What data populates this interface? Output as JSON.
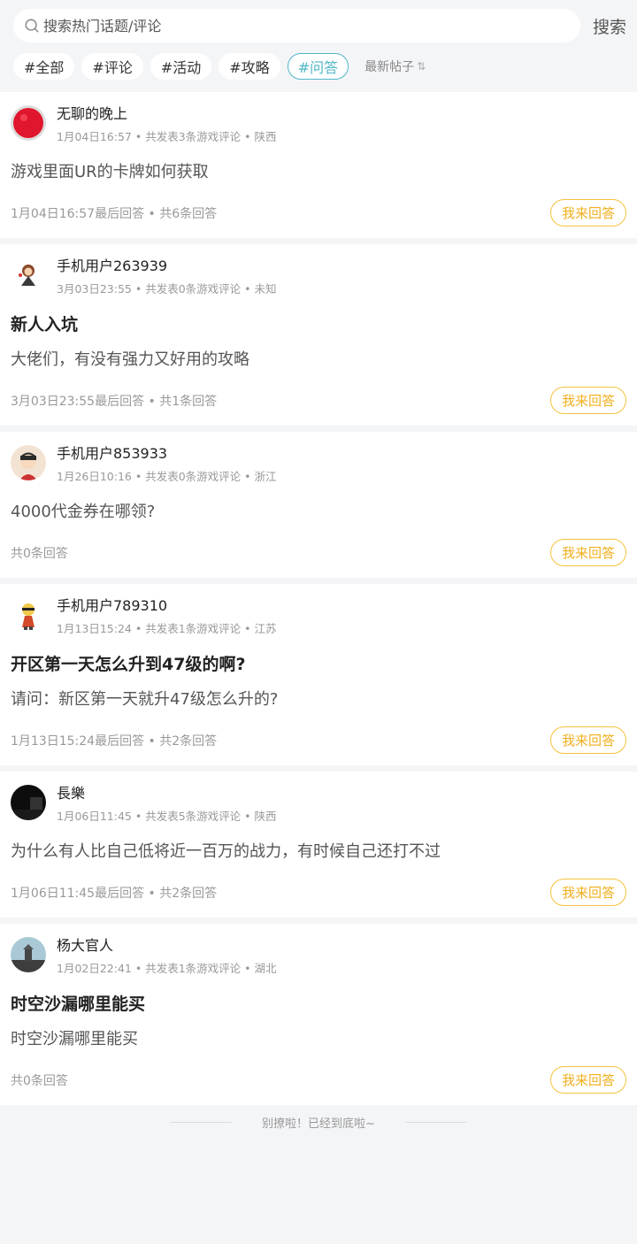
{
  "search": {
    "placeholder": "搜索热门话题/评论",
    "button": "搜索"
  },
  "tags": [
    {
      "label": "#全部",
      "active": false
    },
    {
      "label": "#评论",
      "active": false
    },
    {
      "label": "#活动",
      "active": false
    },
    {
      "label": "#攻略",
      "active": false
    },
    {
      "label": "#问答",
      "active": true
    }
  ],
  "sort": {
    "label": "最新帖子",
    "icon": "sort-arrows-icon"
  },
  "posts": [
    {
      "username": "无聊的晚上",
      "meta": "1月04日16:57 • 共发表3条游戏评论 • 陕西",
      "title": "",
      "body": "游戏里面UR的卡牌如何获取",
      "footer": "1月04日16:57最后回答 • 共6条回答",
      "button": "我来回答"
    },
    {
      "username": "手机用户263939",
      "meta": "3月03日23:55 • 共发表0条游戏评论 • 未知",
      "title": "新人入坑",
      "body": "大佬们，有没有强力又好用的攻略",
      "footer": "3月03日23:55最后回答 • 共1条回答",
      "button": "我来回答"
    },
    {
      "username": "手机用户853933",
      "meta": "1月26日10:16 • 共发表0条游戏评论 • 浙江",
      "title": "",
      "body": "4000代金券在哪领?",
      "footer": "共0条回答",
      "button": "我来回答"
    },
    {
      "username": "手机用户789310",
      "meta": "1月13日15:24 • 共发表1条游戏评论 • 江苏",
      "title": "开区第一天怎么升到47级的啊?",
      "body": "请问：新区第一天就升47级怎么升的?",
      "footer": "1月13日15:24最后回答 • 共2条回答",
      "button": "我来回答"
    },
    {
      "username": "長樂",
      "meta": "1月06日11:45 • 共发表5条游戏评论 • 陕西",
      "title": "",
      "body": "为什么有人比自己低将近一百万的战力，有时候自己还打不过",
      "footer": "1月06日11:45最后回答 • 共2条回答",
      "button": "我来回答"
    },
    {
      "username": "杨大官人",
      "meta": "1月02日22:41 • 共发表1条游戏评论 • 湖北",
      "title": "时空沙漏哪里能买",
      "body": "时空沙漏哪里能买",
      "footer": "共0条回答",
      "button": "我来回答"
    }
  ],
  "end_text": "别撩啦！已经到底啦~"
}
